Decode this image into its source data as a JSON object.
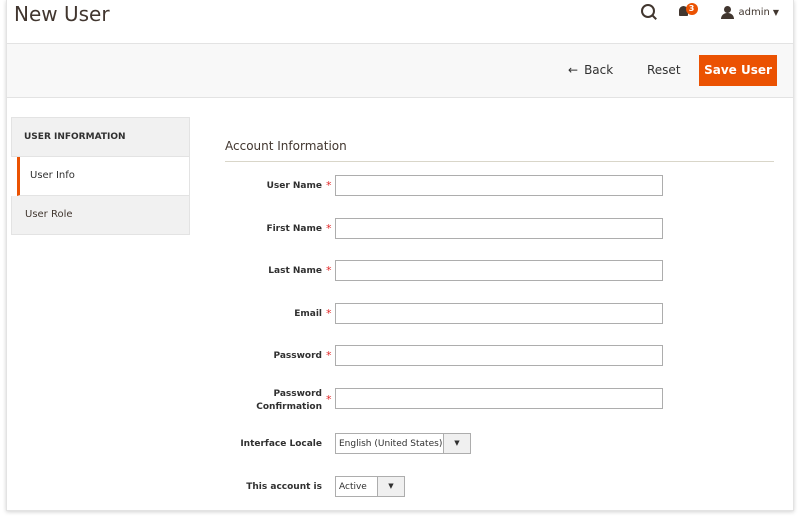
{
  "header": {
    "title": "New User",
    "notifications_count": "3",
    "user_label": "admin",
    "icons": [
      "search-icon",
      "bell-icon",
      "user-icon",
      "chevron-down-icon"
    ]
  },
  "toolbar": {
    "back_label": "Back",
    "reset_label": "Reset",
    "save_label": "Save User"
  },
  "sidebar": {
    "title": "USER INFORMATION",
    "items": [
      {
        "label": "User Info",
        "active": true
      },
      {
        "label": "User Role",
        "active": false
      }
    ]
  },
  "form": {
    "section_title": "Account Information",
    "fields": [
      {
        "label": "User Name",
        "required": true,
        "value": ""
      },
      {
        "label": "First Name",
        "required": true,
        "value": ""
      },
      {
        "label": "Last Name",
        "required": true,
        "value": ""
      },
      {
        "label": "Email",
        "required": true,
        "value": ""
      },
      {
        "label": "Password",
        "required": true,
        "value": ""
      },
      {
        "label_line1": "Password",
        "label_line2": "Confirmation",
        "required": true,
        "value": ""
      }
    ],
    "locale": {
      "label": "Interface Locale",
      "value": "English (United States)"
    },
    "status": {
      "label": "This account is",
      "value": "Active"
    }
  },
  "colors": {
    "accent": "#eb5202",
    "required": "#e22626"
  }
}
